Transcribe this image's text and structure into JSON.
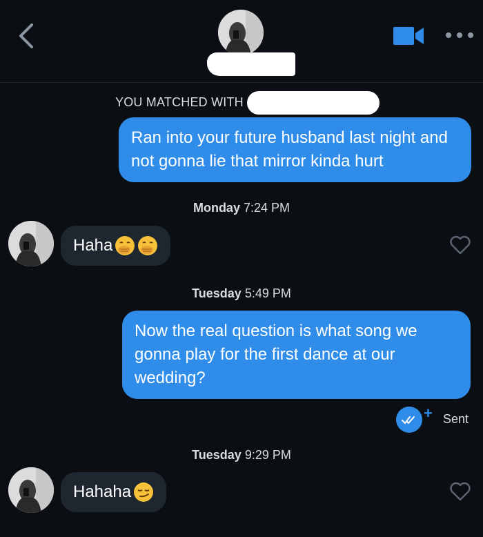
{
  "header": {
    "back_icon": "chevron-left-icon",
    "video_icon": "video-camera-icon",
    "more_icon": "more-dots-icon",
    "accent_color": "#2f8de9"
  },
  "match_banner": {
    "text": "YOU MATCHED WITH"
  },
  "messages": [
    {
      "direction": "outgoing",
      "text": "Ran into your future husband last night and not gonna lie that mirror kinda hurt"
    },
    {
      "timestamp_day": "Monday",
      "timestamp_time": "7:24 PM"
    },
    {
      "direction": "incoming",
      "text": "Haha",
      "emoji": [
        "hand-over-mouth-emoji",
        "hand-over-mouth-emoji"
      ]
    },
    {
      "timestamp_day": "Tuesday",
      "timestamp_time": "5:49 PM"
    },
    {
      "direction": "outgoing",
      "text": "Now the real question is what song we gonna play for the first dance at our wedding?",
      "status": "Sent"
    },
    {
      "timestamp_day": "Tuesday",
      "timestamp_time": "9:29 PM"
    },
    {
      "direction": "incoming",
      "text": "Hahaha",
      "emoji": [
        "smirking-face-emoji"
      ]
    }
  ]
}
